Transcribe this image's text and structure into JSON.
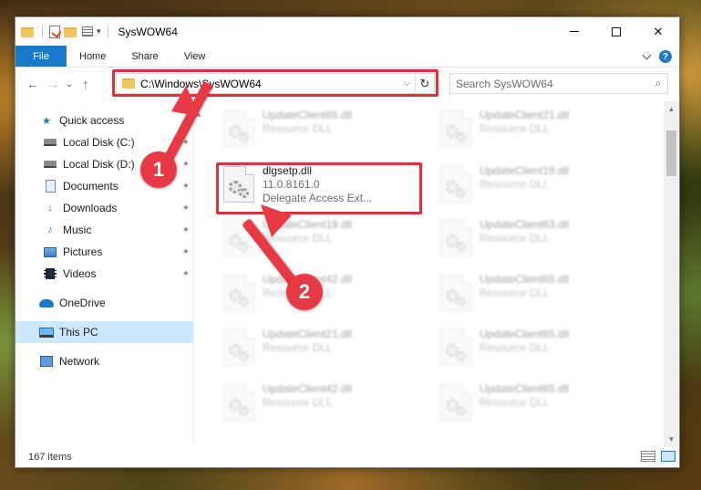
{
  "window": {
    "title": "SysWOW64",
    "caption": {
      "minimize": "—",
      "maximize": "☐",
      "close": "✕"
    }
  },
  "ribbon": {
    "tabs": [
      "File",
      "Home",
      "Share",
      "View"
    ]
  },
  "nav": {
    "back": "←",
    "forward": "→",
    "recent": "⌄",
    "up": "↑",
    "address": "C:\\Windows\\SysWOW64",
    "search_placeholder": "Search SysWOW64"
  },
  "sidebar": {
    "items": [
      {
        "label": "Quick access",
        "icon": "star-icon"
      },
      {
        "label": "Local Disk (C:)",
        "icon": "drive-icon",
        "pinned": true
      },
      {
        "label": "Local Disk (D:)",
        "icon": "drive-icon",
        "pinned": true
      },
      {
        "label": "Documents",
        "icon": "documents-icon",
        "pinned": true
      },
      {
        "label": "Downloads",
        "icon": "download-icon",
        "pinned": true
      },
      {
        "label": "Music",
        "icon": "music-icon",
        "pinned": true
      },
      {
        "label": "Pictures",
        "icon": "pictures-icon",
        "pinned": true
      },
      {
        "label": "Videos",
        "icon": "videos-icon",
        "pinned": true
      },
      {
        "label": "OneDrive",
        "icon": "cloud-icon"
      },
      {
        "label": "This PC",
        "icon": "computer-icon",
        "selected": true
      },
      {
        "label": "Network",
        "icon": "network-icon"
      }
    ],
    "pin_glyph": "📌"
  },
  "files": {
    "left": [
      {
        "name": "UpdateClient65.dll",
        "line2": "Resource DLL"
      },
      {
        "name": "dlgsetp.dll",
        "line2": "11.0.8161.0",
        "line3": "Delegate Access Ext..."
      },
      {
        "name": "UpdateClient19.dll",
        "line2": "Resource DLL"
      },
      {
        "name": "UpdateClient42.dll",
        "line2": "Resource DLL"
      },
      {
        "name": "UpdateClient21.dll",
        "line2": "Resource DLL"
      },
      {
        "name": "UpdateClient42.dll",
        "line2": "Resource DLL"
      }
    ],
    "right": [
      {
        "name": "UpdateClient21.dll",
        "line2": "Resource DLL"
      },
      {
        "name": "UpdateClient19.dll",
        "line2": "Resource DLL"
      },
      {
        "name": "UpdateClient63.dll",
        "line2": "Resource DLL"
      },
      {
        "name": "UpdateClient65.dll",
        "line2": "Resource DLL"
      },
      {
        "name": "UpdateClient65.dll",
        "line2": "Resource DLL"
      },
      {
        "name": "UpdateClient65.dll",
        "line2": "Resource DLL"
      }
    ]
  },
  "status": {
    "count": "167 items"
  },
  "callouts": [
    "1",
    "2"
  ],
  "colors": {
    "accent": "#1979ca",
    "highlight": "#e0303e",
    "selected": "#cce8ff"
  }
}
